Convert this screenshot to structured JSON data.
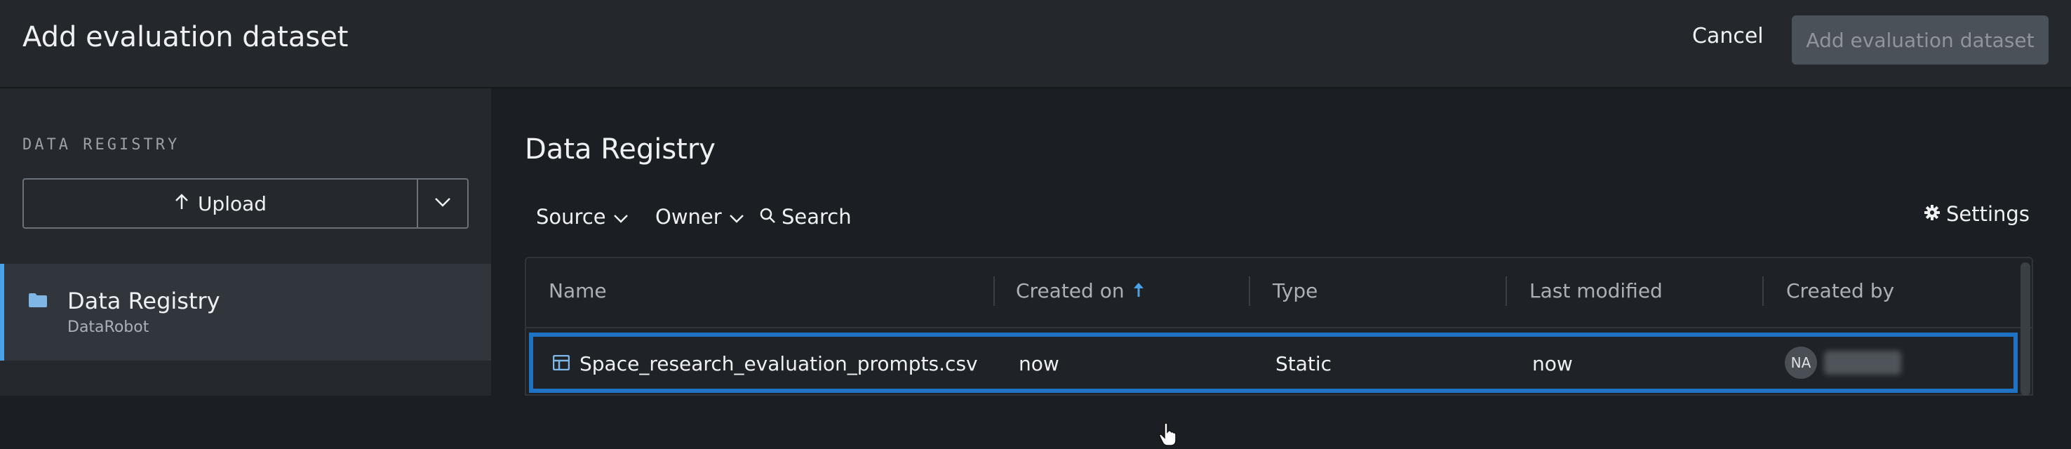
{
  "header": {
    "title": "Add evaluation dataset",
    "cancel_label": "Cancel",
    "add_label": "Add evaluation dataset"
  },
  "sidebar": {
    "heading": "DATA REGISTRY",
    "upload_label": "Upload",
    "items": [
      {
        "label": "Data Registry",
        "sublabel": "DataRobot",
        "icon": "folder-icon",
        "selected": true
      }
    ]
  },
  "main": {
    "title": "Data Registry",
    "filters": {
      "source": "Source",
      "owner": "Owner",
      "search": "Search"
    },
    "settings_label": "Settings",
    "table": {
      "columns": [
        "Name",
        "Created on",
        "Type",
        "Last modified",
        "Created by"
      ],
      "sort": {
        "column": "Created on",
        "direction": "ascending"
      },
      "rows": [
        {
          "name": "Space_research_evaluation_prompts.csv",
          "created_on": "now",
          "type": "Static",
          "last_modified": "now",
          "created_by_initials": "NA",
          "selected": true
        }
      ]
    }
  },
  "colors": {
    "accent": "#1f73c4",
    "selection_bar": "#4aa3e8",
    "sort_arrow": "#4aa3e8"
  }
}
